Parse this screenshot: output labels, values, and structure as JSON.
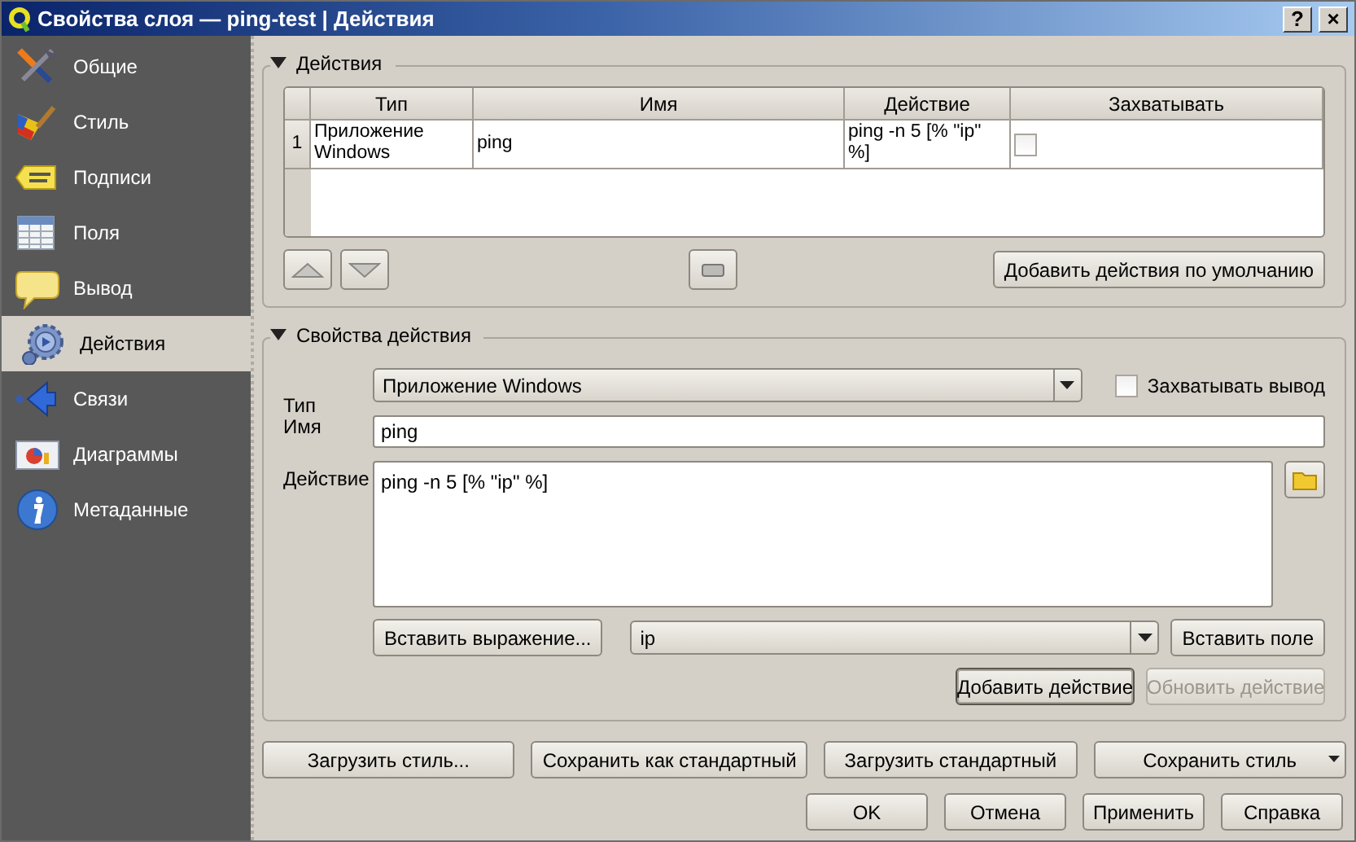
{
  "window": {
    "title": "Свойства слоя — ping-test | Действия",
    "help_button": "?",
    "close_button": "×"
  },
  "sidebar": {
    "items": [
      {
        "label": "Общие",
        "selected": false
      },
      {
        "label": "Стиль",
        "selected": false
      },
      {
        "label": "Подписи",
        "selected": false
      },
      {
        "label": "Поля",
        "selected": false
      },
      {
        "label": "Вывод",
        "selected": false
      },
      {
        "label": "Действия",
        "selected": true
      },
      {
        "label": "Связи",
        "selected": false
      },
      {
        "label": "Диаграммы",
        "selected": false
      },
      {
        "label": "Метаданные",
        "selected": false
      }
    ]
  },
  "actions": {
    "title": "Действия",
    "expanded": true,
    "table": {
      "columns": [
        "Тип",
        "Имя",
        "Действие",
        "Захватывать"
      ],
      "rows": [
        {
          "number": "1",
          "type": "Приложение Windows",
          "name": "ping",
          "action": "ping -n 5 [% \"ip\" %]",
          "capture": false
        }
      ]
    },
    "add_defaults_button": "Добавить действия по умолчанию"
  },
  "properties": {
    "title": "Свойства действия",
    "expanded": true,
    "type_label": "Тип",
    "type_value": "Приложение Windows",
    "capture_output": {
      "label": "Захватывать вывод",
      "checked": false
    },
    "name_label": "Имя",
    "name_value": "ping",
    "action_label": "Действие",
    "action_value": "ping -n 5 [% \"ip\" %]",
    "insert_expression_button": "Вставить выражение...",
    "field_value": "ip",
    "insert_field_button": "Вставить поле",
    "buttons": [
      {
        "label": "Добавить действие",
        "disabled": false
      },
      {
        "label": "Обновить действие",
        "disabled": true
      }
    ]
  },
  "style_buttons": [
    {
      "label": "Загрузить стиль...",
      "menu": false
    },
    {
      "label": "Сохранить как стандартный",
      "menu": false
    },
    {
      "label": "Загрузить стандартный",
      "menu": false
    },
    {
      "label": "Сохранить стиль",
      "menu": true
    }
  ],
  "dialog_buttons": [
    "OK",
    "Отмена",
    "Применить",
    "Справка"
  ]
}
